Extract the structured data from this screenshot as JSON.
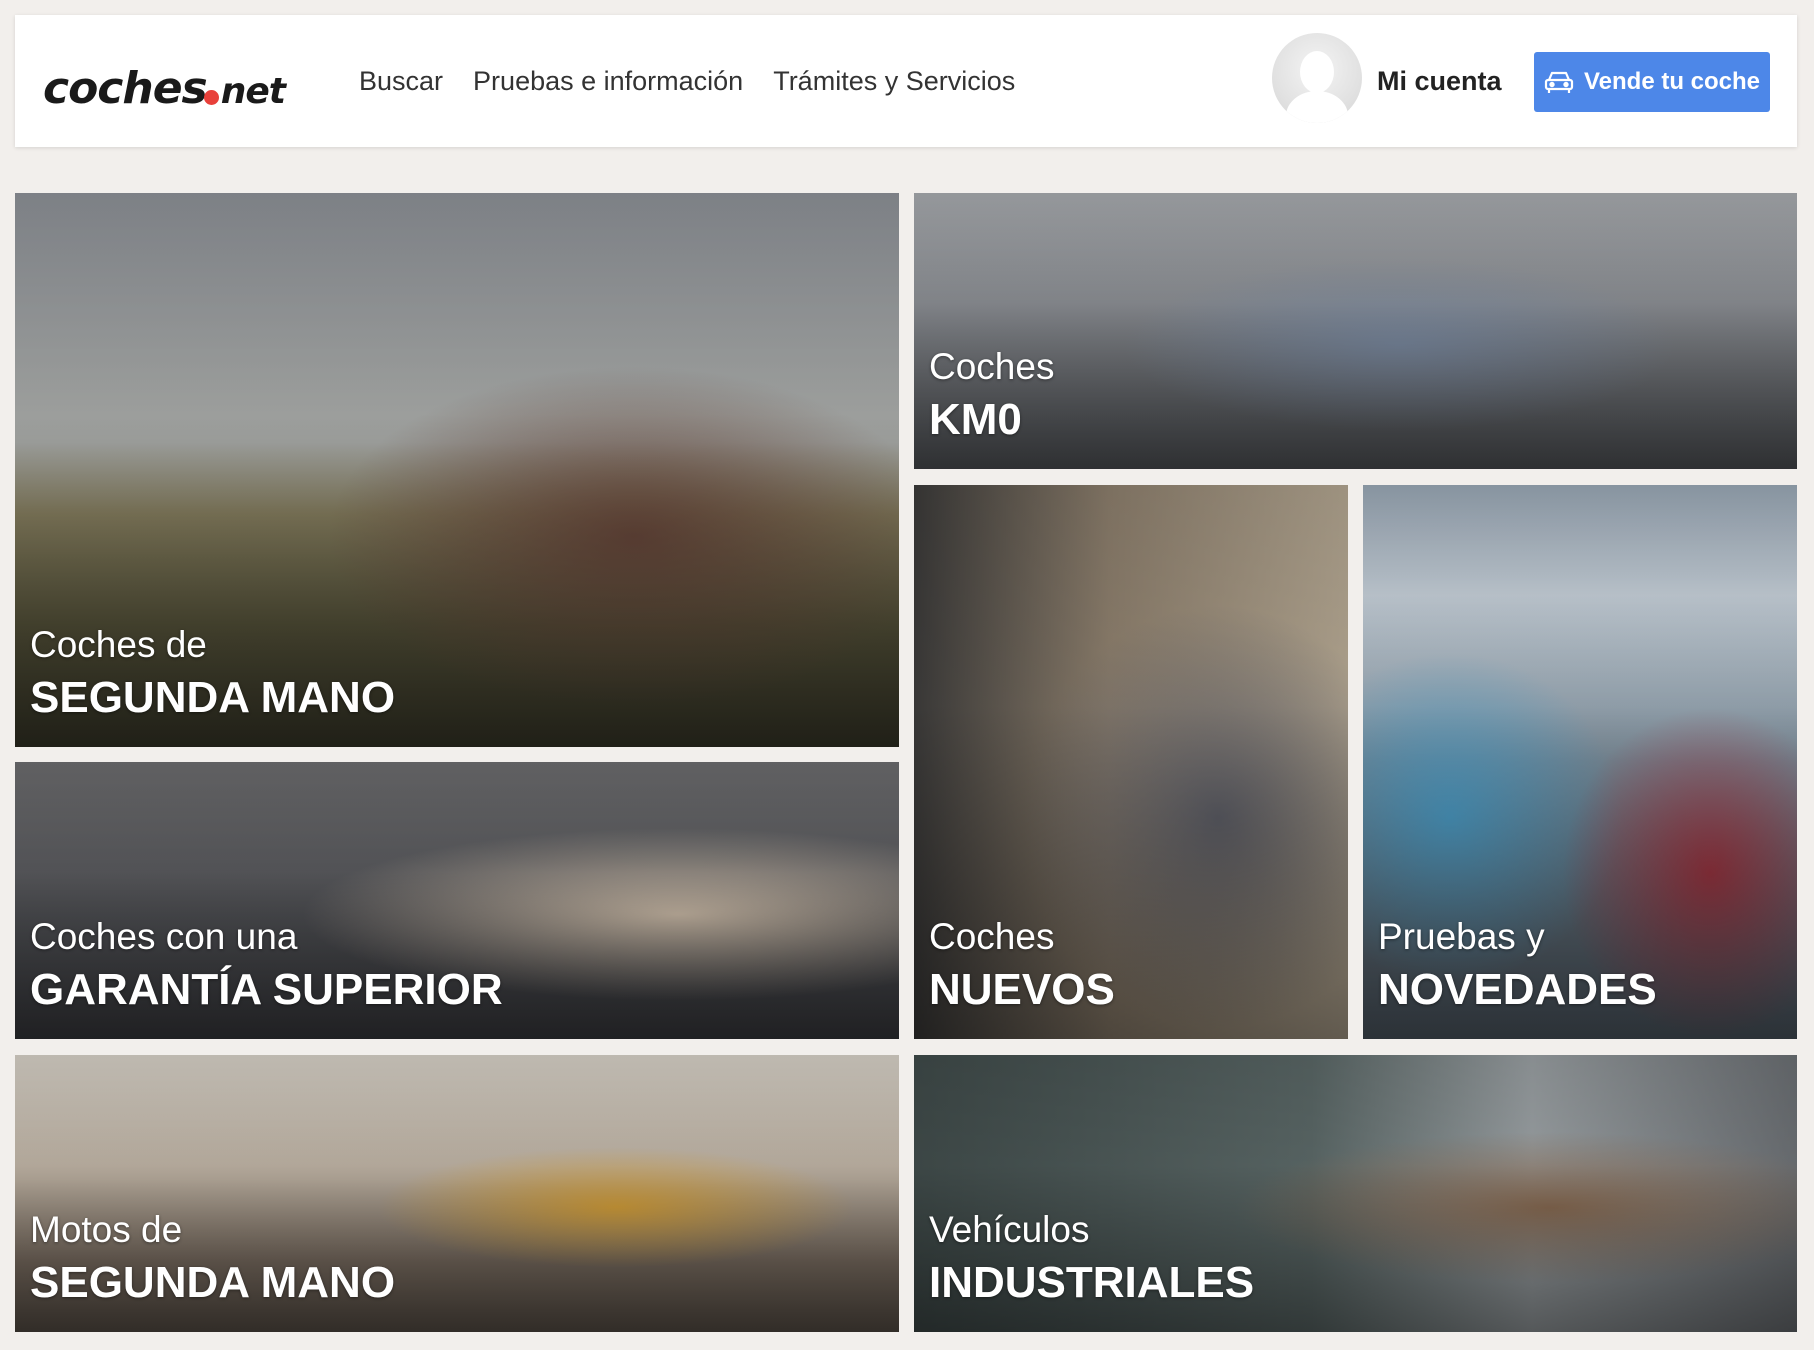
{
  "header": {
    "logo": {
      "main": "coches",
      "tld": "net"
    },
    "nav": [
      "Buscar",
      "Pruebas e información",
      "Trámites y Servicios"
    ],
    "account_label": "Mi cuenta",
    "sell_button_label": "Vende tu coche"
  },
  "tiles": [
    {
      "line1": "Coches de",
      "line2": "SEGUNDA MANO"
    },
    {
      "line1": "Coches",
      "line2": "KM0"
    },
    {
      "line1": "Coches con una",
      "line2": "GARANTÍA SUPERIOR"
    },
    {
      "line1": "Coches",
      "line2": "NUEVOS"
    },
    {
      "line1": "Pruebas y",
      "line2": "NOVEDADES"
    },
    {
      "line1": "Motos de",
      "line2": "SEGUNDA MANO"
    },
    {
      "line1": "Vehículos",
      "line2": "INDUSTRIALES"
    }
  ],
  "colors": {
    "accent_button": "#4d87e8",
    "logo_dot": "#e8403a",
    "page_background": "#f2efec"
  },
  "icons": {
    "sell_button_icon": "car-icon",
    "account_icon": "user-avatar-icon"
  }
}
